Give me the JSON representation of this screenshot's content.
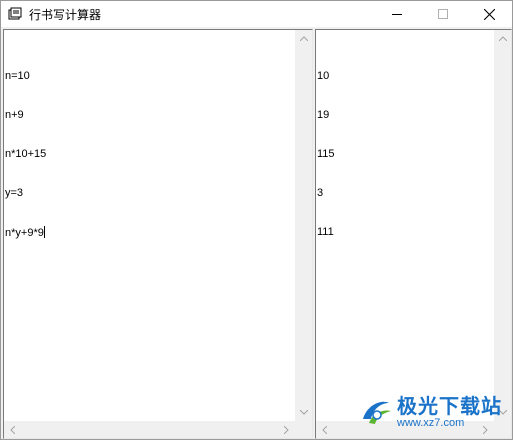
{
  "window": {
    "title": "行书写计算器",
    "controls": {
      "minimize_icon": "minimize-icon",
      "maximize_icon": "maximize-icon",
      "close_icon": "close-icon"
    }
  },
  "input_pane": {
    "lines": [
      "n=10",
      "n+9",
      "n*10+15",
      "y=3",
      "n*y+9*9"
    ]
  },
  "result_pane": {
    "lines": [
      "10",
      "19",
      "115",
      "3",
      "111"
    ]
  },
  "watermark": {
    "name": "极光下载站",
    "url": "www.xz7.com"
  },
  "colors": {
    "watermark_blue": "#1a73c9",
    "watermark_green": "#5cb531",
    "pane_bg": "#ffffff",
    "frame_bg": "#f0f0f0"
  }
}
